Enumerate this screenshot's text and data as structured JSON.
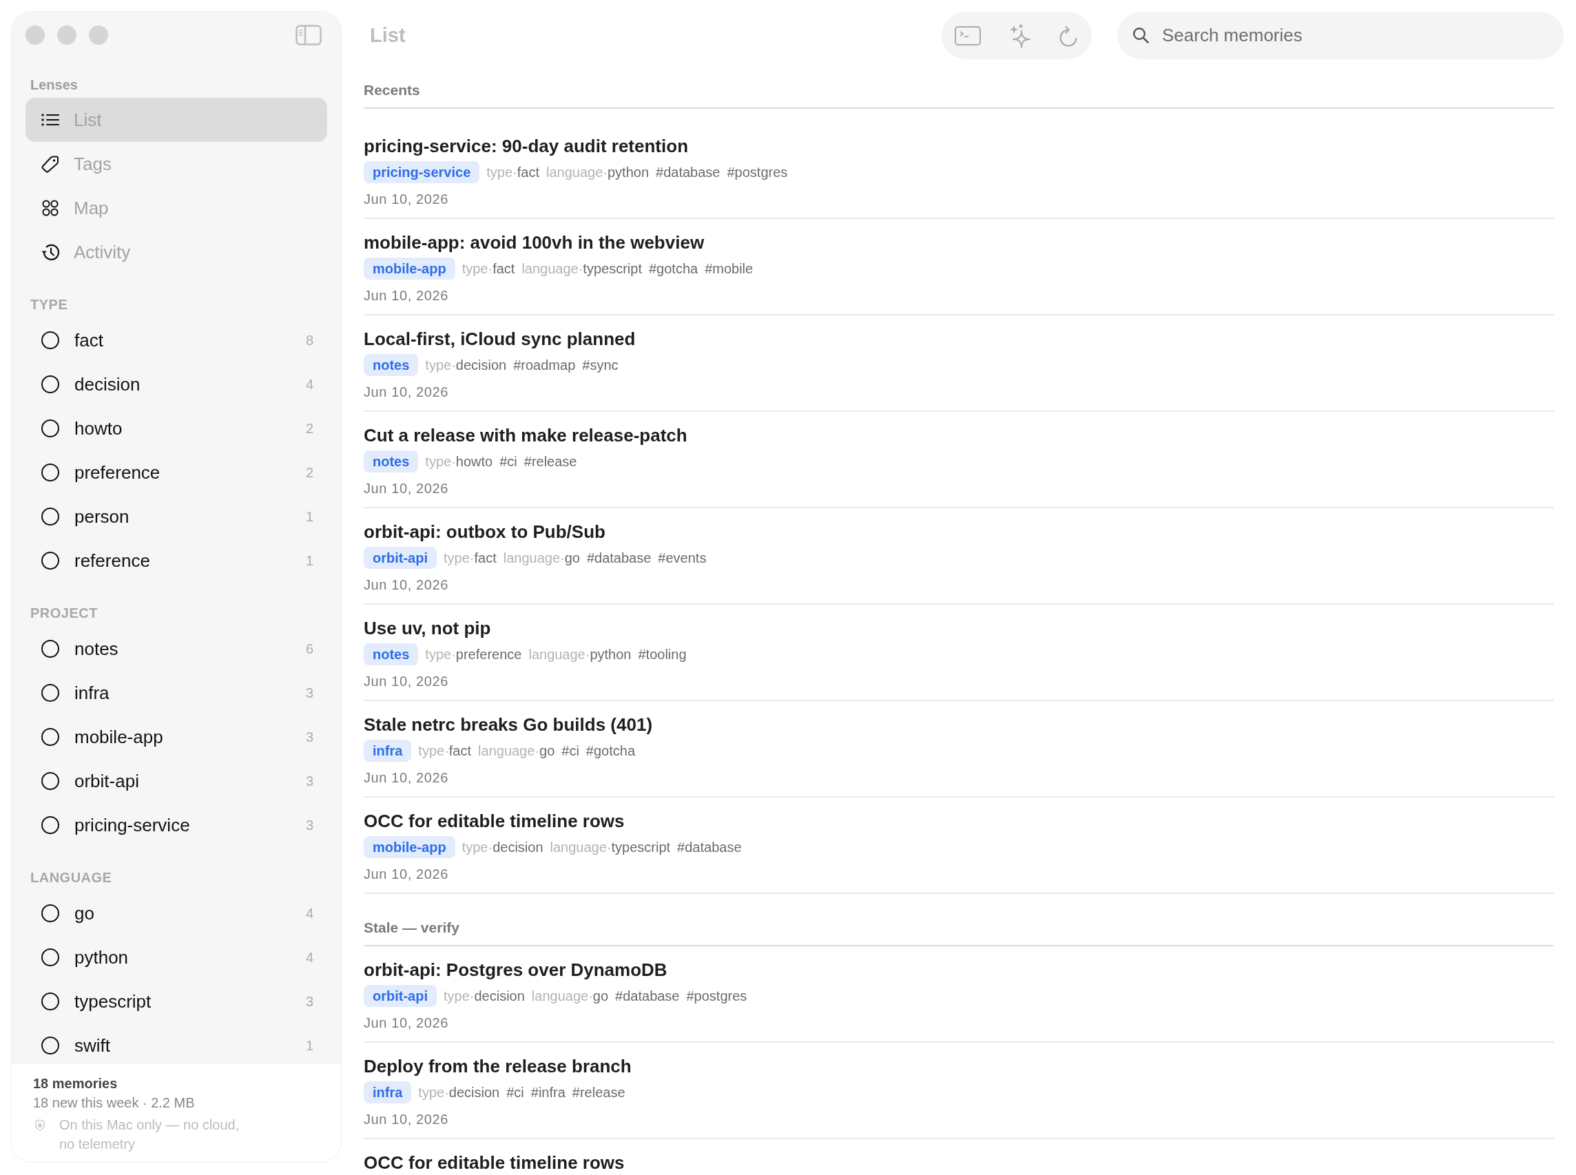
{
  "sidebar": {
    "lenses_heading": "Lenses",
    "lenses": [
      {
        "kind": "list",
        "label": "List",
        "selected": true
      },
      {
        "kind": "tags",
        "label": "Tags",
        "selected": false
      },
      {
        "kind": "map",
        "label": "Map",
        "selected": false
      },
      {
        "kind": "activity",
        "label": "Activity",
        "selected": false
      }
    ],
    "filters": [
      {
        "heading": "TYPE",
        "items": [
          {
            "label": "fact",
            "count": "8",
            "selected": false
          },
          {
            "label": "decision",
            "count": "4",
            "selected": false
          },
          {
            "label": "howto",
            "count": "2",
            "selected": false
          },
          {
            "label": "preference",
            "count": "2",
            "selected": false
          },
          {
            "label": "person",
            "count": "1",
            "selected": false
          },
          {
            "label": "reference",
            "count": "1",
            "selected": false
          }
        ]
      },
      {
        "heading": "PROJECT",
        "items": [
          {
            "label": "notes",
            "count": "6",
            "selected": false
          },
          {
            "label": "infra",
            "count": "3",
            "selected": false
          },
          {
            "label": "mobile-app",
            "count": "3",
            "selected": false
          },
          {
            "label": "orbit-api",
            "count": "3",
            "selected": false
          },
          {
            "label": "pricing-service",
            "count": "3",
            "selected": false
          }
        ]
      },
      {
        "heading": "LANGUAGE",
        "items": [
          {
            "label": "go",
            "count": "4",
            "selected": false
          },
          {
            "label": "python",
            "count": "4",
            "selected": false
          },
          {
            "label": "typescript",
            "count": "3",
            "selected": false
          },
          {
            "label": "swift",
            "count": "1",
            "selected": false
          }
        ]
      }
    ],
    "footer": {
      "count": "18 memories",
      "summary": "18 new this week · 2.2 MB",
      "privacy": "On this Mac only — no cloud, no telemetry"
    }
  },
  "main": {
    "title": "List",
    "search": {
      "placeholder": "Search memories"
    },
    "sections": [
      {
        "heading": "Recents",
        "items": [
          {
            "title": "pricing-service: 90-day audit retention",
            "project": "pricing-service",
            "fields": [
              {
                "key": "type·",
                "value": "fact"
              },
              {
                "key": "language·",
                "value": "python"
              }
            ],
            "tags": [
              "#database",
              "#postgres"
            ],
            "date": "Jun 10, 2026"
          },
          {
            "title": "mobile-app: avoid 100vh in the webview",
            "project": "mobile-app",
            "fields": [
              {
                "key": "type·",
                "value": "fact"
              },
              {
                "key": "language·",
                "value": "typescript"
              }
            ],
            "tags": [
              "#gotcha",
              "#mobile"
            ],
            "date": "Jun 10, 2026"
          },
          {
            "title": "Local-first, iCloud sync planned",
            "project": "notes",
            "fields": [
              {
                "key": "type·",
                "value": "decision"
              }
            ],
            "tags": [
              "#roadmap",
              "#sync"
            ],
            "date": "Jun 10, 2026"
          },
          {
            "title": "Cut a release with make release-patch",
            "project": "notes",
            "fields": [
              {
                "key": "type·",
                "value": "howto"
              }
            ],
            "tags": [
              "#ci",
              "#release"
            ],
            "date": "Jun 10, 2026"
          },
          {
            "title": "orbit-api: outbox to Pub/Sub",
            "project": "orbit-api",
            "fields": [
              {
                "key": "type·",
                "value": "fact"
              },
              {
                "key": "language·",
                "value": "go"
              }
            ],
            "tags": [
              "#database",
              "#events"
            ],
            "date": "Jun 10, 2026"
          },
          {
            "title": "Use uv, not pip",
            "project": "notes",
            "fields": [
              {
                "key": "type·",
                "value": "preference"
              },
              {
                "key": "language·",
                "value": "python"
              }
            ],
            "tags": [
              "#tooling"
            ],
            "date": "Jun 10, 2026"
          },
          {
            "title": "Stale netrc breaks Go builds (401)",
            "project": "infra",
            "fields": [
              {
                "key": "type·",
                "value": "fact"
              },
              {
                "key": "language·",
                "value": "go"
              }
            ],
            "tags": [
              "#ci",
              "#gotcha"
            ],
            "date": "Jun 10, 2026"
          },
          {
            "title": "OCC for editable timeline rows",
            "project": "mobile-app",
            "fields": [
              {
                "key": "type·",
                "value": "decision"
              },
              {
                "key": "language·",
                "value": "typescript"
              }
            ],
            "tags": [
              "#database"
            ],
            "date": "Jun 10, 2026"
          }
        ]
      },
      {
        "heading": "Stale — verify",
        "items": [
          {
            "title": "orbit-api: Postgres over DynamoDB",
            "project": "orbit-api",
            "fields": [
              {
                "key": "type·",
                "value": "decision"
              },
              {
                "key": "language·",
                "value": "go"
              }
            ],
            "tags": [
              "#database",
              "#postgres"
            ],
            "date": "Jun 10, 2026"
          },
          {
            "title": "Deploy from the release branch",
            "project": "infra",
            "fields": [
              {
                "key": "type·",
                "value": "decision"
              }
            ],
            "tags": [
              "#ci",
              "#infra",
              "#release"
            ],
            "date": "Jun 10, 2026"
          },
          {
            "title": "OCC for editable timeline rows"
          }
        ]
      }
    ]
  }
}
